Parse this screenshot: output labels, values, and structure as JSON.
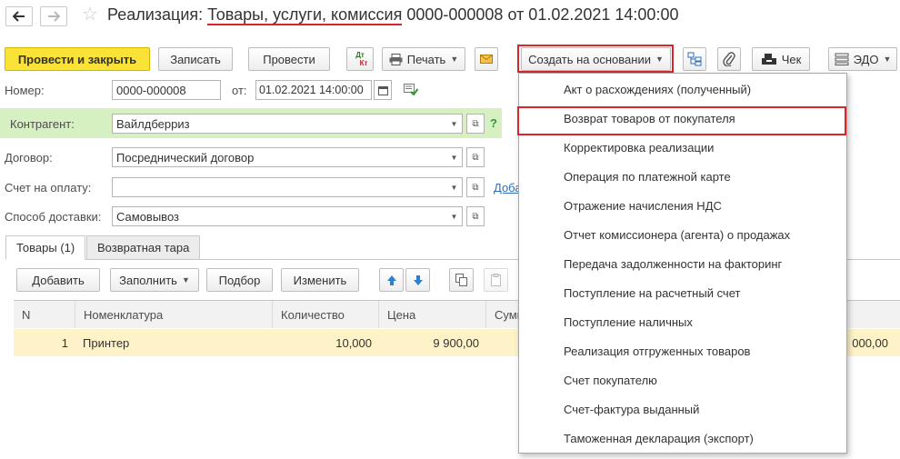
{
  "window": {
    "title_prefix": "Реализация: ",
    "title_underlined": "Товары, услуги, комиссия",
    "title_suffix": " 0000-000008 от 01.02.2021 14:00:00"
  },
  "toolbar": {
    "post_close": "Провести и закрыть",
    "save": "Записать",
    "post": "Провести",
    "dtkt_top": "Дт",
    "dtkt_bottom": "Кт",
    "print": "Печать",
    "create_based": "Создать на основании",
    "receipt": "Чек",
    "edo": "ЭДО"
  },
  "form": {
    "number_label": "Номер:",
    "number_value": "0000-000008",
    "date_label": "от:",
    "date_value": "01.02.2021 14:00:00",
    "counterparty_label": "Контрагент:",
    "counterparty_value": "Вайлдберриз",
    "help": "?",
    "contract_label": "Договор:",
    "contract_value": "Посреднический договор",
    "invoice_label": "Счет на оплату:",
    "invoice_value": "",
    "invoice_link": "Доба",
    "delivery_label": "Способ доставки:",
    "delivery_value": "Самовывоз"
  },
  "tabs": [
    {
      "label": "Товары (1)"
    },
    {
      "label": "Возвратная тара"
    }
  ],
  "table_toolbar": {
    "add": "Добавить",
    "fill": "Заполнить",
    "select": "Подбор",
    "change": "Изменить"
  },
  "table": {
    "columns": [
      "N",
      "Номенклатура",
      "Количество",
      "Цена",
      "Сумм"
    ],
    "rows": [
      {
        "n": "1",
        "item": "Принтер",
        "qty": "10,000",
        "price": "9 900,00",
        "total_tail": "000,00"
      }
    ]
  },
  "menu": {
    "items": [
      "Акт о расхождениях (полученный)",
      "Возврат товаров от покупателя",
      "Корректировка реализации",
      "Операция по платежной карте",
      "Отражение начисления НДС",
      "Отчет комиссионера (агента) о продажах",
      "Передача задолженности на факторинг",
      "Поступление на расчетный счет",
      "Поступление наличных",
      "Реализация отгруженных товаров",
      "Счет покупателю",
      "Счет-фактура выданный",
      "Таможенная декларация (экспорт)"
    ]
  },
  "colors": {
    "primary_button": "#fbe236",
    "highlight_red": "#d9262b",
    "counterparty_row": "#d6f0c2",
    "selected_row": "#fdf2c8"
  }
}
